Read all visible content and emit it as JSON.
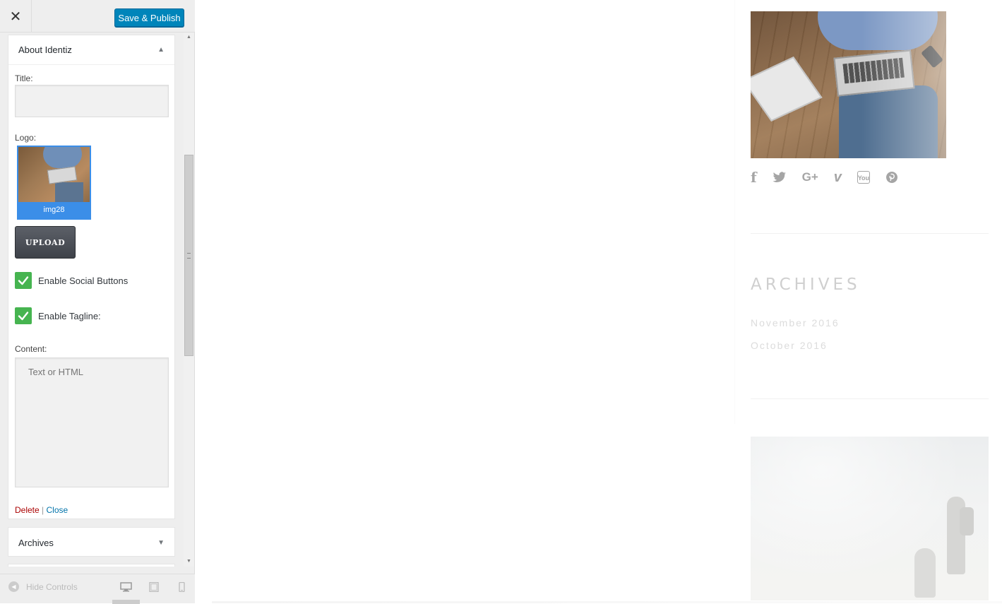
{
  "header": {
    "close_label": "✕",
    "publish_label": "Save & Publish"
  },
  "about_widget": {
    "title": "About Identiz",
    "title_label": "Title:",
    "title_value": "",
    "logo_label": "Logo:",
    "logo_caption": "img28",
    "upload_label": "UPLOAD",
    "social_label": "Enable Social Buttons",
    "social_checked": true,
    "tagline_label": "Enable Tagline:",
    "tagline_checked": true,
    "content_label": "Content:",
    "content_placeholder": "Text or HTML",
    "delete_label": "Delete",
    "separator": "|",
    "close_label": "Close"
  },
  "archives_widget": {
    "title": "Archives"
  },
  "footer": {
    "hide_controls_label": "Hide Controls"
  },
  "preview": {
    "social_icons": [
      "facebook-icon",
      "twitter-icon",
      "google-plus-icon",
      "vimeo-icon",
      "youtube-icon",
      "pinterest-icon"
    ],
    "social_glyphs": {
      "facebook": "f",
      "google_plus": "G+",
      "vimeo": "v",
      "youtube": "You"
    },
    "archives_title": "ARCHIVES",
    "archive_links": [
      "November 2016",
      "October 2016"
    ]
  },
  "colors": {
    "publish_blue": "#0085ba",
    "check_green": "#46b450",
    "delete_red": "#aa0000",
    "link_blue": "#0073aa",
    "social_grey": "#a5a5a5"
  }
}
